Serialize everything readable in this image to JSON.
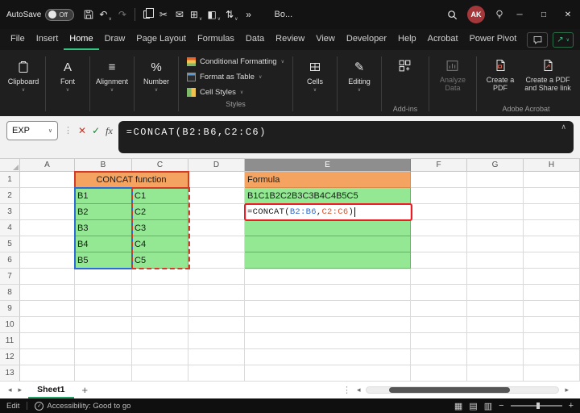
{
  "titlebar": {
    "autosave_label": "AutoSave",
    "autosave_state": "Off",
    "title": "Bo...",
    "avatar": "AK"
  },
  "menubar": {
    "items": [
      "File",
      "Insert",
      "Home",
      "Draw",
      "Page Layout",
      "Formulas",
      "Data",
      "Review",
      "View",
      "Developer",
      "Help",
      "Acrobat",
      "Power Pivot"
    ],
    "active": "Home"
  },
  "ribbon": {
    "clipboard_label": "Clipboard",
    "font_label": "Font",
    "alignment_label": "Alignment",
    "number_label": "Number",
    "styles": {
      "items": [
        "Conditional Formatting",
        "Format as Table",
        "Cell Styles"
      ],
      "label": "Styles"
    },
    "cells_label": "Cells",
    "editing_label": "Editing",
    "addins_label": "Add-ins",
    "analyze_label": "Analyze Data",
    "acrobat": {
      "buttons": [
        "Create a PDF",
        "Create a PDF and Share link"
      ],
      "label": "Adobe Acrobat"
    }
  },
  "formula_bar": {
    "name_box": "EXP",
    "formula": "=CONCAT(B2:B6,C2:C6)"
  },
  "grid": {
    "column_headers": [
      "A",
      "B",
      "C",
      "D",
      "E",
      "F",
      "G",
      "H"
    ],
    "row_headers": [
      "1",
      "2",
      "3",
      "4",
      "5",
      "6",
      "7",
      "8",
      "9",
      "10",
      "11",
      "12",
      "13"
    ],
    "selected_column": "E",
    "cells": {
      "b1": "CONCAT function",
      "e1": "Formula",
      "b": [
        "B1",
        "B2",
        "B3",
        "B4",
        "B5"
      ],
      "c": [
        "C1",
        "C2",
        "C3",
        "C4",
        "C5"
      ],
      "e2": "B1C1B2C2B3C3B4C4B5C5",
      "e3": {
        "prefix": "=CONCAT(",
        "range1": "B2:B6",
        "separator": ",",
        "range2": "C2:C6",
        "suffix": ")"
      }
    }
  },
  "sheet_bar": {
    "tabs": [
      "Sheet1"
    ],
    "active_tab": "Sheet1"
  },
  "status_bar": {
    "mode": "Edit",
    "accessibility": "Accessibility: Good to go"
  },
  "icons": {
    "save": "shape",
    "undo": "↶",
    "redo": "↷",
    "copy": "shape",
    "cut": "✂",
    "mail": "✉",
    "borders": "⊞",
    "fill_color": "◧",
    "sort": "⇅",
    "more": "»",
    "chevron_down": "∨",
    "chevron_up": "∧",
    "dots": "⋮",
    "cancel": "✕",
    "enter": "✓",
    "fx": "fx",
    "minimize": "─",
    "maximize": "□",
    "close": "✕",
    "share": "↗",
    "percent": "%",
    "align_lines": "≡",
    "font_letter": "A",
    "pencil": "✎",
    "nav_left": "◂",
    "nav_right": "▸",
    "add_sheet": "+",
    "view_normal": "▦",
    "view_layout": "▤",
    "view_break": "▥",
    "zoom_out": "−",
    "zoom_in": "+"
  },
  "colors": {
    "accent_green": "#21a366",
    "green_fill": "#94e894",
    "orange_fill": "#f4a460",
    "range1_blue": "#2b6bd8",
    "range2_red": "#d13b27",
    "active_cell_border": "#ee1b24",
    "avatar_bg": "#a4373a"
  }
}
